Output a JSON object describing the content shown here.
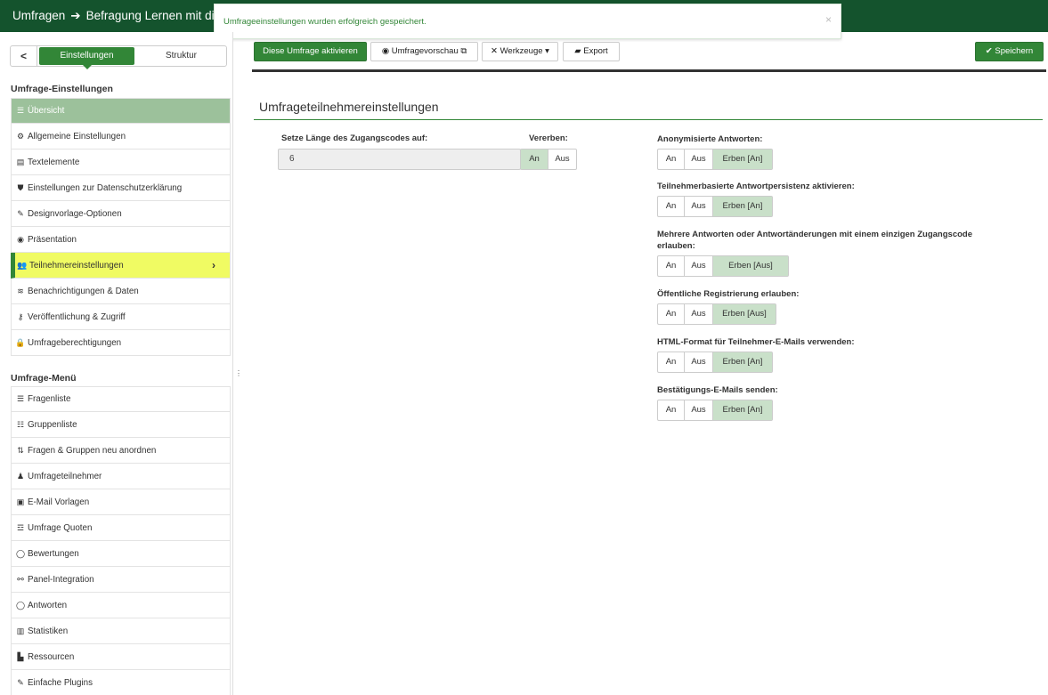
{
  "header": {
    "title": "Umfragen",
    "survey": "Befragung Lernen mit digit"
  },
  "notification": {
    "message": "Umfrageeinstellungen wurden erfolgreich gespeichert.",
    "close": "×"
  },
  "sidebar": {
    "back": "<",
    "tab_settings": "Einstellungen",
    "tab_structure": "Struktur",
    "section1_title": "Umfrage-Einstellungen",
    "section1_items": [
      {
        "label": "Übersicht",
        "icon": "☰"
      },
      {
        "label": "Allgemeine Einstellungen",
        "icon": "⚙"
      },
      {
        "label": "Textelemente",
        "icon": "▤"
      },
      {
        "label": "Einstellungen zur Datenschutzerklärung",
        "icon": "⛊"
      },
      {
        "label": "Designvorlage-Optionen",
        "icon": "✎"
      },
      {
        "label": "Präsentation",
        "icon": "◉"
      },
      {
        "label": "Teilnehmereinstellungen",
        "icon": "👥"
      },
      {
        "label": "Benachrichtigungen & Daten",
        "icon": "≋"
      },
      {
        "label": "Veröffentlichung & Zugriff",
        "icon": "⚷"
      },
      {
        "label": "Umfrageberechtigungen",
        "icon": "🔒"
      }
    ],
    "section2_title": "Umfrage-Menü",
    "section2_items": [
      {
        "label": "Fragenliste",
        "icon": "☰"
      },
      {
        "label": "Gruppenliste",
        "icon": "☷"
      },
      {
        "label": "Fragen & Gruppen neu anordnen",
        "icon": "⇅"
      },
      {
        "label": "Umfrageteilnehmer",
        "icon": "♟"
      },
      {
        "label": "E-Mail Vorlagen",
        "icon": "▣"
      },
      {
        "label": "Umfrage Quoten",
        "icon": "☲"
      },
      {
        "label": "Bewertungen",
        "icon": "◯"
      },
      {
        "label": "Panel-Integration",
        "icon": "⚯"
      },
      {
        "label": "Antworten",
        "icon": "◯"
      },
      {
        "label": "Statistiken",
        "icon": "▥"
      },
      {
        "label": "Ressourcen",
        "icon": "▙"
      },
      {
        "label": "Einfache Plugins",
        "icon": "✎"
      }
    ]
  },
  "toolbar": {
    "activate": "Diese Umfrage aktivieren",
    "preview": "Umfragevorschau",
    "tools": "Werkzeuge",
    "export": "Export",
    "save": "Speichern"
  },
  "panel": {
    "title": "Umfrageteilnehmereinstellungen",
    "code_length_label": "Setze Länge des Zugangscodes auf:",
    "code_length_value": "6",
    "inherit_label": "Vererben:",
    "inherit_on": "An",
    "inherit_off": "Aus",
    "options": [
      {
        "label": "Anonymisierte Antworten:",
        "label2": "",
        "on": "An",
        "off": "Aus",
        "inherit": "Erben [An]"
      },
      {
        "label": "Teilnehmerbasierte Antwortpersistenz aktivieren:",
        "label2": "",
        "on": "An",
        "off": "Aus",
        "inherit": "Erben [An]"
      },
      {
        "label": "Mehrere Antworten oder Antwortänderungen mit einem einzigen Zugangscode",
        "label2": "erlauben:",
        "on": "An",
        "off": "Aus",
        "inherit": "Erben [Aus]"
      },
      {
        "label": "Öffentliche Registrierung erlauben:",
        "label2": "",
        "on": "An",
        "off": "Aus",
        "inherit": "Erben [Aus]"
      },
      {
        "label": "HTML-Format für Teilnehmer-E-Mails verwenden:",
        "label2": "",
        "on": "An",
        "off": "Aus",
        "inherit": "Erben [An]"
      },
      {
        "label": "Bestätigungs-E-Mails senden:",
        "label2": "",
        "on": "An",
        "off": "Aus",
        "inherit": "Erben [An]"
      }
    ]
  },
  "colors": {
    "brand_dark": "#14532d",
    "brand": "#328637",
    "highlight": "#f0fb63",
    "selected_segment": "#c9e0c9"
  }
}
